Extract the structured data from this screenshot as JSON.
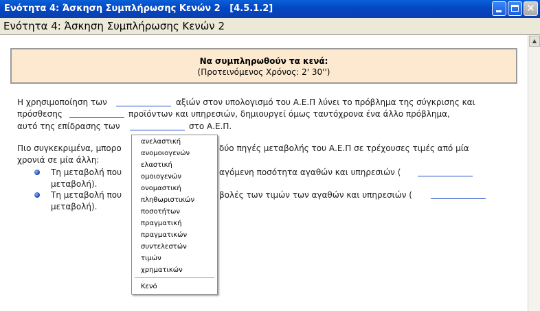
{
  "window": {
    "title": "Ενότητα 4: Άσκηση Συμπλήρωσης Κενών 2   [4.5.1.2]",
    "header": "Ενότητα 4: Άσκηση Συμπλήρωσης Κενών 2"
  },
  "banner": {
    "line1": "Να συμπληρωθούν τα κενά:",
    "line2": "(Προτεινόμενος Χρόνος: 2' 30'')"
  },
  "text": {
    "p1_a": "Η χρησιμοποίηση των",
    "p1_b": "αξιών στον υπολογισμό του Α.Ε.Π λύνει το πρόβλημα της σύγκρισης και",
    "p1_c": "πρόσθεσης",
    "p1_d": "προϊόντων και υπηρεσιών, δημιουργεί όμως ταυτόχρονα ένα άλλο πρόβλημα,",
    "p1_e": "αυτό της επίδρασης των",
    "p1_f": "στο Α.Ε.Π.",
    "p2_a": "Πιο συγκεκριμένα, μπορο",
    "p2_b": "δύο πηγές μεταβολής του Α.Ε.Π σε τρέχουσες τιμές από μία",
    "p2_c": "χρονιά σε μία άλλη:",
    "b1_a": "Τη μεταβολή που",
    "b1_b": "αγόμενη ποσότητα αγαθών και υπηρεσιών (",
    "b1_c": "μεταβολή).",
    "b2_a": "Τη μεταβολή που",
    "b2_b": "βολές των τιμών των αγαθών και υπηρεσιών (",
    "b2_c": "μεταβολή)."
  },
  "menu": {
    "items": [
      "ανελαστική",
      "ανομοιογενών",
      "ελαστική",
      "ομοιογενών",
      "ονομαστική",
      "πληθωριστικών",
      "ποσοτήτων",
      "πραγματική",
      "πραγματικών",
      "συντελεστών",
      "τιμών",
      "χρηματικών"
    ],
    "empty": "Κενό"
  }
}
